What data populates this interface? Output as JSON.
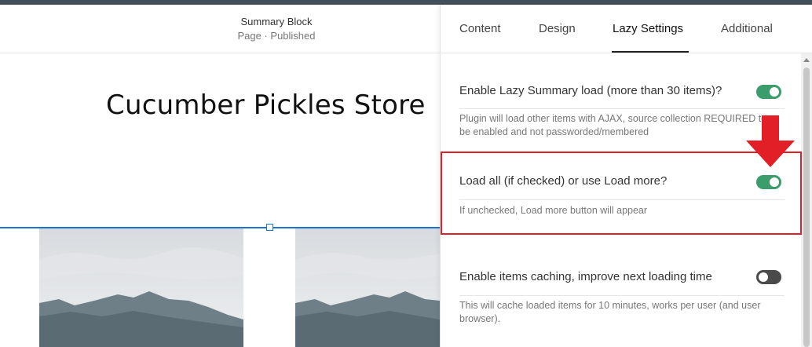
{
  "editor": {
    "block_title": "Summary Block",
    "block_status": "Page · Published"
  },
  "page": {
    "heading": "Cucumber Pickles Store"
  },
  "panel": {
    "tabs": [
      {
        "label": "Content",
        "active": false
      },
      {
        "label": "Design",
        "active": false
      },
      {
        "label": "Lazy Settings",
        "active": true
      },
      {
        "label": "Additional",
        "active": false
      }
    ],
    "settings": [
      {
        "label": "Enable Lazy Summary load (more than 30 items)?",
        "description": "Plugin will load other items with AJAX, source collection REQUIRED to be enabled and not passworded/membered",
        "enabled": true
      },
      {
        "label": "Load all (if checked) or use Load more?",
        "description": "If unchecked, Load more button will appear",
        "enabled": true
      },
      {
        "label": "Enable items caching, improve next loading time",
        "description": "This will cache loaded items for 10 minutes, works per user (and user browser).",
        "enabled": false
      }
    ]
  },
  "colors": {
    "toggle_on": "#3b9c6c",
    "toggle_off": "#4a4a4a",
    "selection": "#1e73cf",
    "annotation": "#e21e26"
  },
  "icons": {
    "annotation_arrow": "down-arrow-icon"
  }
}
